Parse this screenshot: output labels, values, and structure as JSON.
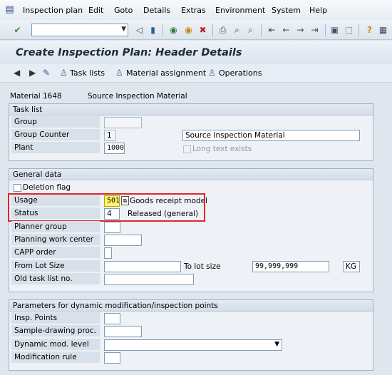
{
  "menu": {
    "items": [
      "Inspection plan",
      "Edit",
      "Goto",
      "Details",
      "Extras",
      "Environment",
      "System",
      "Help"
    ]
  },
  "toolbar": {
    "command_field": {
      "value": "",
      "placeholder": ""
    },
    "icons": [
      "enter-icon",
      "save-icon",
      "back-icon",
      "exit-icon",
      "cancel-icon",
      "print-icon",
      "find-icon",
      "find-next-icon",
      "first-page-icon",
      "prev-page-icon",
      "next-page-icon",
      "last-page-icon",
      "new-session-icon",
      "shortcut-icon",
      "help-icon",
      "layout-icon"
    ]
  },
  "title": "Create Inspection Plan: Header Details",
  "app_toolbar": {
    "prev_icon": "arrow-left-icon",
    "next_icon": "arrow-right-icon",
    "edit_icon": "pencil-icon",
    "task_lists": "Task lists",
    "material_assignment": "Material assignment",
    "operations": "Operations"
  },
  "material": {
    "label": "Material",
    "number": "1648",
    "description": "Source Inspection Material"
  },
  "task_list": {
    "title": "Task list",
    "group_label": "Group",
    "group_value": "",
    "group_counter_label": "Group Counter",
    "group_counter_value": "1",
    "description_value": "Source Inspection Material",
    "plant_label": "Plant",
    "plant_value": "1000",
    "long_text_label": "Long text exists"
  },
  "general_data": {
    "title": "General data",
    "deletion_flag_label": "Deletion flag",
    "usage_label": "Usage",
    "usage_value": "501",
    "usage_text": "Goods receipt model",
    "status_label": "Status",
    "status_value": "4",
    "status_text": "Released (general)",
    "planner_group_label": "Planner group",
    "planning_work_center_label": "Planning work center",
    "capp_order_label": "CAPP order",
    "from_lot_size_label": "From Lot Size",
    "from_lot_size_value": "",
    "to_lot_size_label": "To lot size",
    "to_lot_size_value": "99,999,999",
    "unit_value": "KG",
    "old_task_list_label": "Old task list no."
  },
  "dynamic_params": {
    "title": "Parameters for dynamic modification/inspection points",
    "insp_points_label": "Insp. Points",
    "sample_drawing_label": "Sample-drawing proc.",
    "dynamic_mod_level_label": "Dynamic mod. level",
    "modification_rule_label": "Modification rule"
  },
  "colors": {
    "highlight": "#e0272a",
    "usage_field": "#fff46f",
    "title_text": "#1c2a3c"
  }
}
